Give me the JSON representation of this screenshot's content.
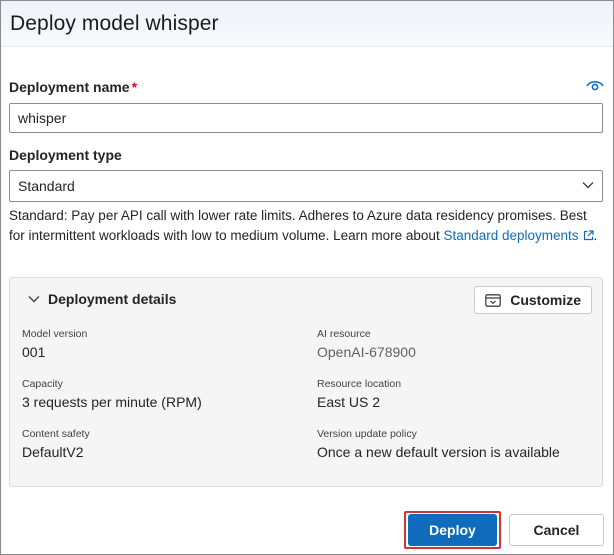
{
  "dialog": {
    "title": "Deploy model whisper"
  },
  "deployment_name": {
    "label": "Deployment name",
    "required_mark": "*",
    "value": "whisper"
  },
  "deployment_type": {
    "label": "Deployment type",
    "selected": "Standard",
    "description_prefix": "Standard: Pay per API call with lower rate limits. Adheres to Azure data residency promises. Best for intermittent workloads with low to medium volume. Learn more about ",
    "link_text": "Standard deployments",
    "description_suffix": "."
  },
  "details": {
    "title": "Deployment details",
    "customize_label": "Customize",
    "model_version_label": "Model version",
    "model_version_value": "001",
    "ai_resource_label": "AI resource",
    "ai_resource_value": "OpenAI-678900",
    "capacity_label": "Capacity",
    "capacity_value": "3 requests per minute (RPM)",
    "resource_location_label": "Resource location",
    "resource_location_value": "East US 2",
    "content_safety_label": "Content safety",
    "content_safety_value": "DefaultV2",
    "version_update_label": "Version update policy",
    "version_update_value": "Once a new default version is available"
  },
  "footer": {
    "deploy_label": "Deploy",
    "cancel_label": "Cancel"
  },
  "colors": {
    "accent": "#0f6cbd",
    "highlight_outline": "#d13438",
    "required": "#c50f1f"
  },
  "icons": [
    "eye-icon",
    "chevron-down-icon",
    "external-link-icon",
    "customize-icon"
  ]
}
